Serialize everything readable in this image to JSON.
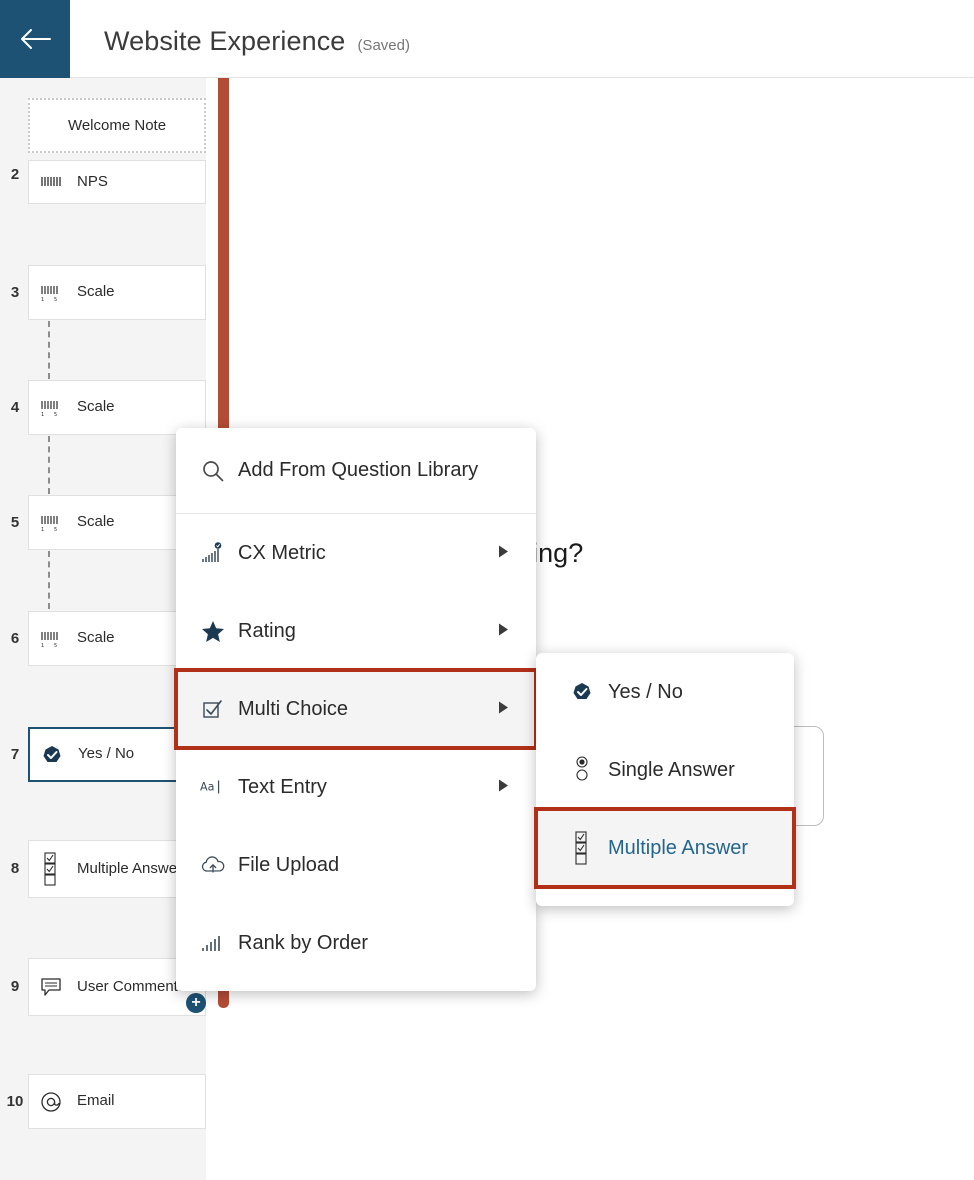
{
  "header": {
    "back_icon": "arrow-left-icon",
    "title": "Website Experience",
    "saved_label": "(Saved)",
    "accent_color": "#1d5274"
  },
  "sidebar": {
    "welcome_note": {
      "label": "Welcome Note"
    },
    "hierarchy_icon": "hierarchy-icon",
    "add_icon": "plus-circle-icon",
    "items": [
      {
        "num": "2",
        "label": "NPS",
        "icon": "nps-scale-icon",
        "selected": false
      },
      {
        "num": "3",
        "label": "Scale",
        "icon": "scale-icon",
        "selected": false
      },
      {
        "num": "4",
        "label": "Scale",
        "icon": "scale-icon",
        "selected": false
      },
      {
        "num": "5",
        "label": "Scale",
        "icon": "scale-icon",
        "selected": false
      },
      {
        "num": "6",
        "label": "Scale",
        "icon": "scale-icon",
        "selected": false
      },
      {
        "num": "7",
        "label": "Yes / No",
        "icon": "yes-no-icon",
        "selected": true
      },
      {
        "num": "8",
        "label": "Multiple Answer",
        "icon": "checkbox-list-icon",
        "selected": false
      },
      {
        "num": "9",
        "label": "User Comments",
        "icon": "comment-icon",
        "selected": false
      },
      {
        "num": "10",
        "label": "Email",
        "icon": "at-sign-icon",
        "selected": false
      }
    ]
  },
  "main": {
    "question_text": "trouble finding anything?",
    "progress_bar_color": "#b44c35"
  },
  "menu": {
    "search_item": {
      "label": "Add From Question Library",
      "icon": "search-icon"
    },
    "items": [
      {
        "label": "CX Metric",
        "icon": "cx-metric-icon",
        "has_submenu": true,
        "highlighted": false
      },
      {
        "label": "Rating",
        "icon": "star-icon",
        "has_submenu": true,
        "highlighted": false
      },
      {
        "label": "Multi Choice",
        "icon": "checkbox-icon",
        "has_submenu": true,
        "highlighted": true
      },
      {
        "label": "Text Entry",
        "icon": "text-entry-icon",
        "has_submenu": true,
        "highlighted": false
      },
      {
        "label": "File Upload",
        "icon": "cloud-upload-icon",
        "has_submenu": false,
        "highlighted": false
      },
      {
        "label": "Rank by Order",
        "icon": "bar-rank-icon",
        "has_submenu": false,
        "highlighted": false
      }
    ],
    "highlight_color": "#b03018"
  },
  "submenu": {
    "items": [
      {
        "label": "Yes / No",
        "icon": "check-badge-icon",
        "highlighted": false
      },
      {
        "label": "Single Answer",
        "icon": "radio-list-icon",
        "highlighted": false
      },
      {
        "label": "Multiple Answer",
        "icon": "checkbox-list-icon",
        "highlighted": true
      }
    ]
  }
}
